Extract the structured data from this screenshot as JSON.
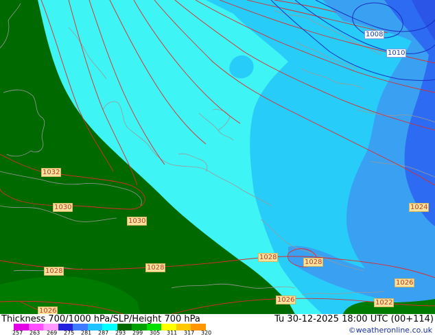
{
  "title": "Thickness 700/1000 hPa/SLP/Height 700 hPa",
  "datetime": "Tu 30-12-2025 18:00 UTC (00+114)",
  "credit": "©weatheronline.co.uk",
  "scale": {
    "ticks": [
      "257",
      "263",
      "269",
      "275",
      "281",
      "287",
      "293",
      "299",
      "305",
      "311",
      "317",
      "320"
    ],
    "colors": [
      "#e400e4",
      "#ff4dff",
      "#ff99ff",
      "#2222dd",
      "#3f7bff",
      "#1fc3ff",
      "#00ffff",
      "#006a00",
      "#00a000",
      "#00e000",
      "#ffff00",
      "#ffc800",
      "#ff9600"
    ]
  },
  "colors": {
    "green_dark": "#006a00",
    "green_mid": "#007a00",
    "cyan": "#3ff4f4",
    "sky": "#27ccf9",
    "blue_light": "#3aa0f2",
    "blue": "#2d6cf2",
    "slp_line": "#dd2b2b",
    "height_line": "#1a2fbf",
    "coast": "#9a9a9a"
  },
  "isobars": [
    {
      "label": "1008",
      "kind": "lo"
    },
    {
      "label": "1010",
      "kind": "lo"
    },
    {
      "label": "1032",
      "kind": "hi"
    },
    {
      "label": "1030",
      "kind": "hi"
    },
    {
      "label": "1030",
      "kind": "hi"
    },
    {
      "label": "1028",
      "kind": "hi"
    },
    {
      "label": "1028",
      "kind": "hi"
    },
    {
      "label": "1028",
      "kind": "hi"
    },
    {
      "label": "1028",
      "kind": "hi"
    },
    {
      "label": "1026",
      "kind": "hi"
    },
    {
      "label": "1026",
      "kind": "hi"
    },
    {
      "label": "1026",
      "kind": "hi"
    },
    {
      "label": "1024",
      "kind": "hi"
    },
    {
      "label": "1022",
      "kind": "hi"
    }
  ]
}
